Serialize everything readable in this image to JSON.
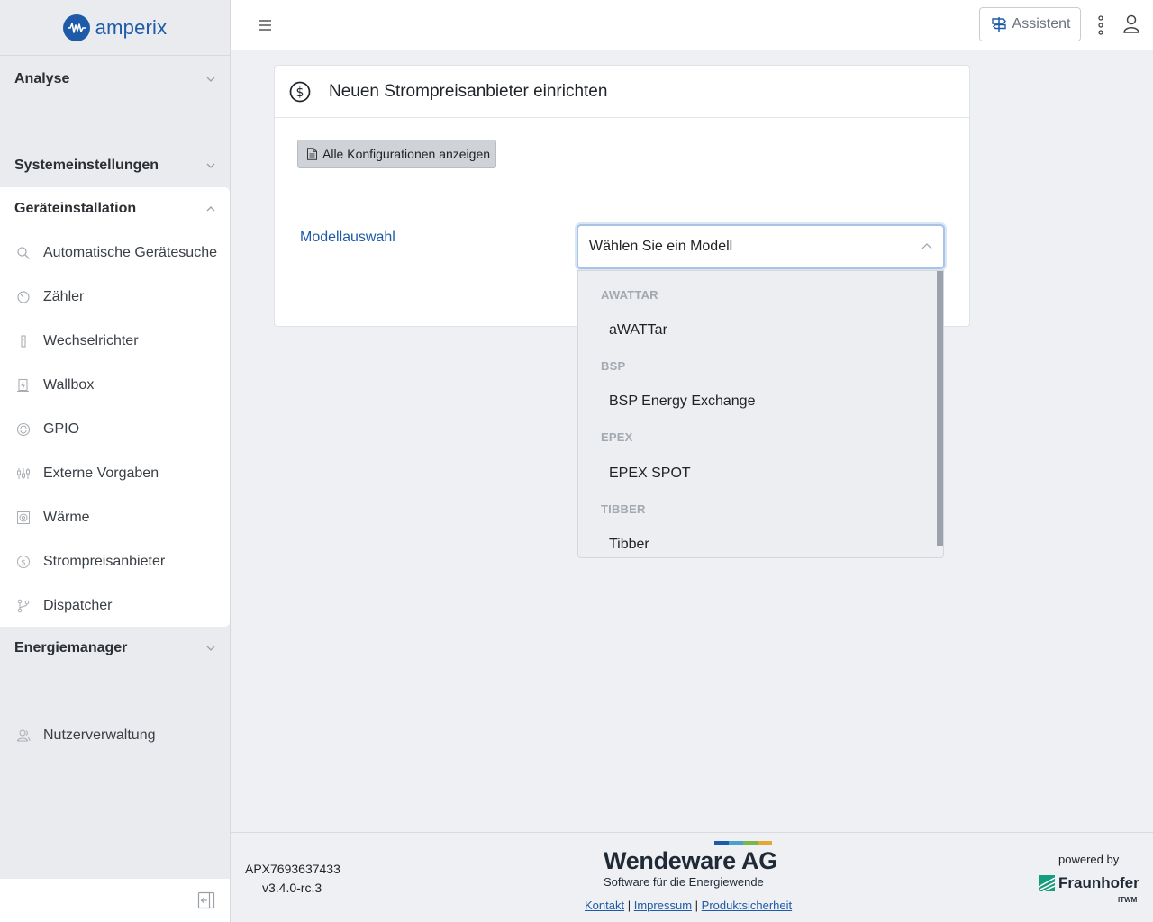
{
  "app": {
    "logo_text": "amperix",
    "brand_color": "#1e5aa8",
    "accent_color": "#1e5aa8"
  },
  "sidebar": {
    "sections": [
      {
        "label": "Analyse",
        "icon": "chevron-down-icon"
      },
      {
        "label": "Systemeinstellungen",
        "icon": "chevron-down-icon"
      },
      {
        "label": "Geräteinstallation",
        "icon": "chevron-up-icon"
      },
      {
        "label": "Energiemanager",
        "icon": "chevron-down-icon"
      }
    ],
    "items": [
      {
        "label": "Automatische Gerätesuche",
        "icon": "search-icon"
      },
      {
        "label": "Zähler",
        "icon": "meter-icon"
      },
      {
        "label": "Wechselrichter",
        "icon": "inverter-icon"
      },
      {
        "label": "Wallbox",
        "icon": "wallbox-icon"
      },
      {
        "label": "GPIO",
        "icon": "gpio-icon"
      },
      {
        "label": "Externe Vorgaben",
        "icon": "sliders-icon"
      },
      {
        "label": "Wärme",
        "icon": "heat-icon"
      },
      {
        "label": "Strompreisanbieter",
        "icon": "dollar-icon"
      },
      {
        "label": "Dispatcher",
        "icon": "branch-icon"
      }
    ],
    "user_management": {
      "label": "Nutzerverwaltung",
      "icon": "users-icon"
    },
    "collapse_icon": "collapse-icon"
  },
  "topbar": {
    "menu_icon": "hamburger-icon",
    "assistant_label": "Assistent",
    "assistant_icon": "signpost-icon",
    "more_icon": "kebab-icon",
    "user_icon": "user-icon"
  },
  "card": {
    "title": "Neuen Strompreisanbieter einrichten",
    "title_icon": "dollar-circle-icon",
    "config_button_label": "Alle Konfigurationen anzeigen",
    "config_button_icon": "document-icon",
    "model_label": "Modellauswahl",
    "model_select": {
      "value": "Wählen Sie ein Modell",
      "open": true,
      "groups": [
        {
          "label": "AWATTAR",
          "options": [
            "aWATTar"
          ]
        },
        {
          "label": "BSP",
          "options": [
            "BSP Energy Exchange"
          ]
        },
        {
          "label": "EPEX",
          "options": [
            "EPEX SPOT"
          ]
        },
        {
          "label": "TIBBER",
          "options": [
            "Tibber"
          ]
        }
      ]
    }
  },
  "footer": {
    "serial": "APX7693637433",
    "version": "v3.4.0-rc.3",
    "company": "Wendeware AG",
    "company_sub": "Software für die Energiewende",
    "links": [
      "Kontakt",
      "Impressum",
      "Produktsicherheit"
    ],
    "link_separator": "|",
    "powered_by": "powered by",
    "partner": "Fraunhofer",
    "partner_sub": "ITWM",
    "bar_colors": [
      "#1e5aa8",
      "#4aa1c9",
      "#7bb64a",
      "#e3a734"
    ]
  }
}
